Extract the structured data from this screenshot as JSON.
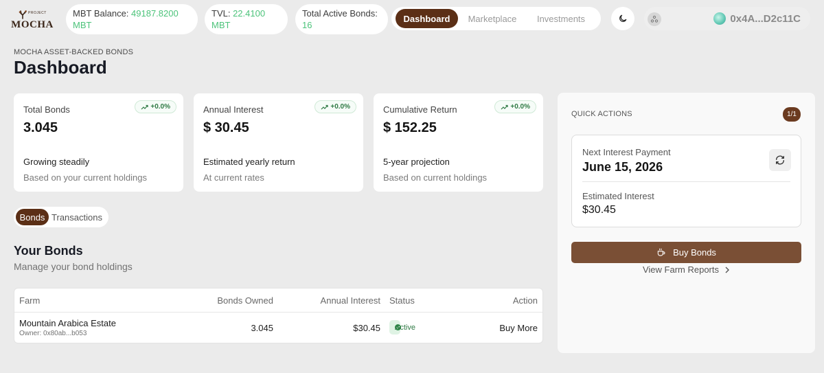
{
  "brand": {
    "small_text": "PROJECT",
    "name": "MOCHA"
  },
  "stats": {
    "mbt_balance_label": "MBT Balance: ",
    "mbt_balance_value": "49187.8200",
    "mbt_balance_unit": "MBT",
    "tvl_label": "TVL: ",
    "tvl_value": "22.4100",
    "tvl_unit": "MBT",
    "active_bonds_label": "Total Active Bonds:",
    "active_bonds_value": "16"
  },
  "nav": {
    "tabs": [
      "Dashboard",
      "Marketplace",
      "Investments"
    ],
    "active": "Dashboard"
  },
  "wallet": {
    "address": "0x4A...D2c11C"
  },
  "header": {
    "eyebrow": "MOCHA ASSET-BACKED BONDS",
    "title": "Dashboard"
  },
  "cards": [
    {
      "label": "Total Bonds",
      "badge": "+0.0%",
      "value": "3.045",
      "desc": "Growing steadily",
      "sub": "Based on your current holdings"
    },
    {
      "label": "Annual Interest",
      "badge": "+0.0%",
      "value": "$ 30.45",
      "desc": "Estimated yearly return",
      "sub": "At current rates"
    },
    {
      "label": "Cumulative Return",
      "badge": "+0.0%",
      "value": "$ 152.25",
      "desc": "5-year projection",
      "sub": "Based on current holdings"
    }
  ],
  "subtabs": [
    "Bonds",
    "Transactions"
  ],
  "bonds_section": {
    "title": "Your Bonds",
    "subtitle": "Manage your bond holdings"
  },
  "table": {
    "columns": [
      "Farm",
      "Bonds Owned",
      "Annual Interest",
      "Status",
      "Action"
    ],
    "rows": [
      {
        "farm": "Mountain Arabica Estate",
        "owner": "Owner: 0x80ab...b053",
        "owned": "3.045",
        "interest": "$30.45",
        "status": "Active",
        "action": "Buy More"
      }
    ]
  },
  "quick_actions": {
    "title": "QUICK ACTIONS",
    "count": "1/1",
    "next_payment_label": "Next Interest Payment",
    "next_payment_date": "June 15, 2026",
    "estimated_label": "Estimated Interest",
    "estimated_value": "$30.45",
    "buy_label": "Buy Bonds",
    "reports_label": "View Farm Reports"
  },
  "colors": {
    "brand_brown": "#5b2f16",
    "positive_green": "#4cc37a",
    "buy_button": "#7a4f35"
  },
  "icons": [
    "tree-logo-icon",
    "moon-icon",
    "network-icon",
    "wallet-avatar-icon",
    "trend-up-icon",
    "refresh-icon",
    "coffee-cup-icon",
    "chevron-right-icon",
    "check-circle-icon"
  ]
}
